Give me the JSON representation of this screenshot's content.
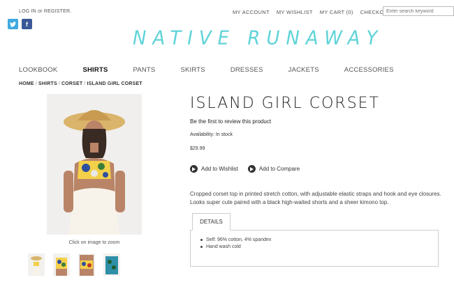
{
  "header": {
    "login_label": "LOG IN or REGISTER.",
    "links": [
      "MY ACCOUNT",
      "MY WISHLIST",
      "MY CART (0)",
      "CHECKOUT"
    ],
    "search_placeholder": "Enter search keyword",
    "logo_text": "NATIVE RUNAWAY"
  },
  "social": {
    "twitter_glyph": "𝕥",
    "facebook_glyph": "f"
  },
  "nav": {
    "items": [
      "LOOKBOOK",
      "SHIRTS",
      "PANTS",
      "SKIRTS",
      "DRESSES",
      "JACKETS",
      "ACCESSORIES"
    ],
    "active": "SHIRTS"
  },
  "breadcrumb": {
    "home": "HOME",
    "category": "SHIRTS",
    "subcategory": "CORSET",
    "current": "ISLAND GIRL CORSET"
  },
  "product": {
    "title": "ISLAND GIRL CORSET",
    "review_text": "Be the first to review this product",
    "availability": "Availability: In stock",
    "price": "$29.99",
    "wishlist_label": "Add to Wishlist",
    "compare_label": "Add to Compare",
    "description": "Cropped corset top in printed stretch cotton, with adjustable elastic straps and hook and eye closures. Looks super cute paired with a black high-waited shorts and a sheer kimono top.",
    "zoom_caption": "Click on image to zoom"
  },
  "details": {
    "tab_label": "DETAILS",
    "items": [
      "Self: 96% cotton, 4% spandex",
      "Hand wash cold"
    ]
  },
  "colors": {
    "logo": "#5fd3d8",
    "twitter": "#3fa9e0",
    "facebook": "#3b5998"
  }
}
